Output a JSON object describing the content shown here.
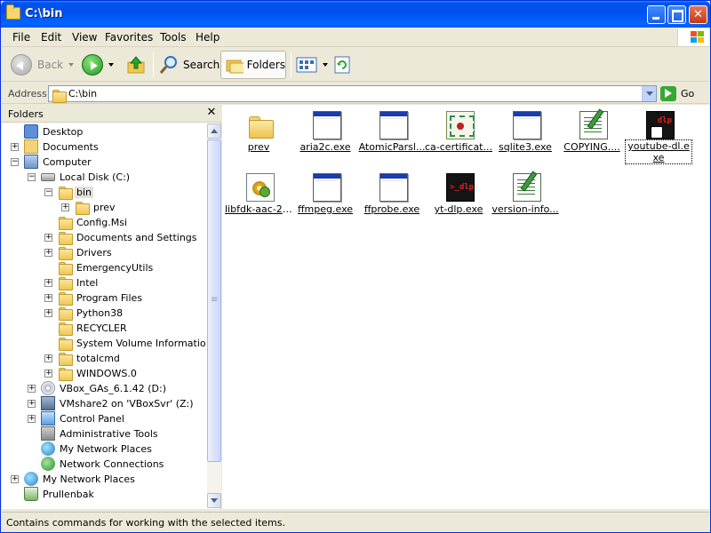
{
  "window": {
    "title": "C:\\bin"
  },
  "menu": [
    "File",
    "Edit",
    "View",
    "Favorites",
    "Tools",
    "Help"
  ],
  "toolbar": {
    "back_label": "Back",
    "search_label": "Search",
    "folders_label": "Folders"
  },
  "address": {
    "label": "Address",
    "value": "C:\\bin",
    "go_label": "Go"
  },
  "folders_pane": {
    "title": "Folders",
    "tree": [
      {
        "label": "Desktop",
        "icon": "desktop-icon",
        "expander": ""
      },
      {
        "label": "Documents",
        "icon": "documents-icon",
        "expander": "+"
      },
      {
        "label": "Computer",
        "icon": "computer-icon",
        "expander": "−"
      },
      {
        "label": "Local Disk (C:)",
        "icon": "drive-icon",
        "expander": "−"
      },
      {
        "label": "bin",
        "icon": "folder-icon",
        "expander": "−",
        "selected": true
      },
      {
        "label": "prev",
        "icon": "folder-icon",
        "expander": "+"
      },
      {
        "label": "Config.Msi",
        "icon": "folder-icon",
        "expander": ""
      },
      {
        "label": "Documents and Settings",
        "icon": "folder-icon",
        "expander": "+"
      },
      {
        "label": "Drivers",
        "icon": "folder-icon",
        "expander": "+"
      },
      {
        "label": "EmergencyUtils",
        "icon": "folder-icon",
        "expander": ""
      },
      {
        "label": "Intel",
        "icon": "folder-icon",
        "expander": "+"
      },
      {
        "label": "Program Files",
        "icon": "folder-icon",
        "expander": "+"
      },
      {
        "label": "Python38",
        "icon": "folder-icon",
        "expander": "+"
      },
      {
        "label": "RECYCLER",
        "icon": "folder-icon",
        "expander": ""
      },
      {
        "label": "System Volume Information",
        "icon": "folder-icon",
        "expander": ""
      },
      {
        "label": "totalcmd",
        "icon": "folder-icon",
        "expander": "+"
      },
      {
        "label": "WINDOWS.0",
        "icon": "folder-icon",
        "expander": "+"
      },
      {
        "label": "VBox_GAs_6.1.42 (D:)",
        "icon": "cd-drive-icon",
        "expander": "+"
      },
      {
        "label": "VMshare2 on 'VBoxSvr' (Z:)",
        "icon": "network-drive-icon",
        "expander": "+"
      },
      {
        "label": "Control Panel",
        "icon": "control-panel-icon",
        "expander": "+"
      },
      {
        "label": "Administrative Tools",
        "icon": "admin-tools-icon",
        "expander": ""
      },
      {
        "label": "My Network Places",
        "icon": "network-places-icon",
        "expander": ""
      },
      {
        "label": "Network Connections",
        "icon": "network-connections-icon",
        "expander": ""
      },
      {
        "label": "My Network Places",
        "icon": "network-places-icon",
        "expander": "+"
      },
      {
        "label": "Prullenbak",
        "icon": "recycle-bin-icon",
        "expander": ""
      }
    ]
  },
  "files": [
    {
      "name": "prev",
      "icon": "folder-icon"
    },
    {
      "name": "aria2c.exe",
      "icon": "exe-icon"
    },
    {
      "name": "AtomicParsl...",
      "icon": "exe-icon"
    },
    {
      "name": "ca-certificat...",
      "icon": "certificate-icon"
    },
    {
      "name": "sqlite3.exe",
      "icon": "exe-icon"
    },
    {
      "name": "COPYING....",
      "icon": "text-document-icon"
    },
    {
      "name": "youtube-dl.exe",
      "icon": "youtube-dl-icon"
    },
    {
      "name": "libfdk-aac-2.dll",
      "icon": "dll-icon"
    },
    {
      "name": "ffmpeg.exe",
      "icon": "exe-icon"
    },
    {
      "name": "ffprobe.exe",
      "icon": "exe-icon"
    },
    {
      "name": "yt-dlp.exe",
      "icon": "yt-dlp-icon"
    },
    {
      "name": "version-info...",
      "icon": "text-document-icon"
    }
  ],
  "status": {
    "text": "Contains commands for working with the selected items."
  },
  "colors": {
    "titlebar": "#0053ee",
    "chrome": "#ece9d8",
    "accent": "#0831d9"
  }
}
